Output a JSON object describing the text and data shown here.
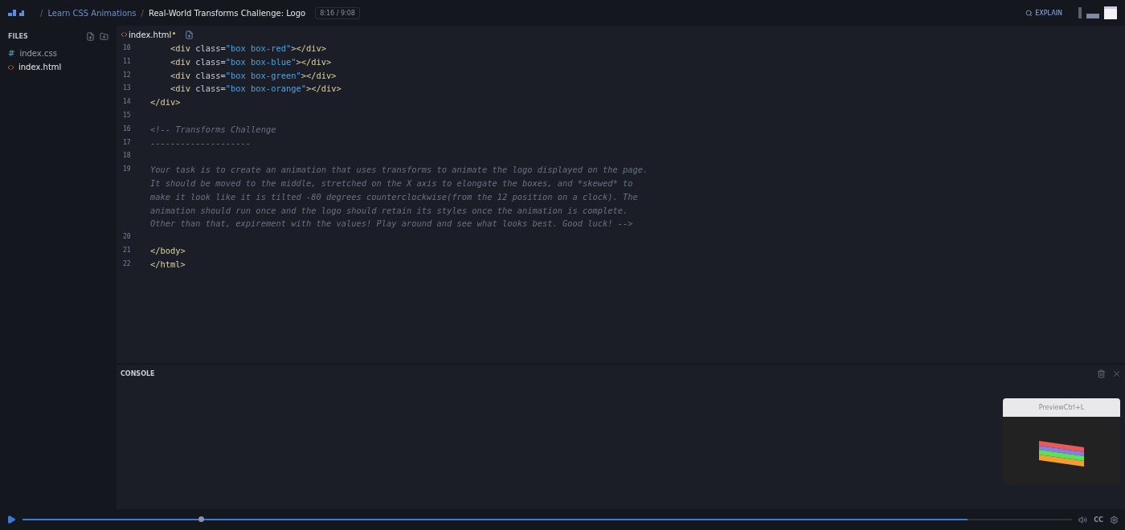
{
  "header": {
    "crumbs": [
      {
        "separator": "/",
        "label": "Learn CSS Animations",
        "kind": "link"
      },
      {
        "separator": "/",
        "label": "Real-World Transforms Challenge: Logo",
        "kind": "current"
      }
    ],
    "time": "8:16 / 9:08",
    "explain": "EXPLAIN"
  },
  "sidebar": {
    "title": "FILES",
    "files": [
      {
        "name": "index.css",
        "kind": "css",
        "glyph": "#",
        "selected": false
      },
      {
        "name": "index.html",
        "kind": "html",
        "selected": true
      }
    ]
  },
  "editor": {
    "tab": {
      "name": "index.html",
      "modified": true
    },
    "lines": [
      {
        "n": "10",
        "kind": "nested",
        "tokens": [
          {
            "kind": "tag",
            "t": "<div "
          },
          {
            "kind": "attr",
            "t": "class="
          },
          {
            "kind": "str",
            "t": "\"box box-red\""
          },
          {
            "kind": "tag",
            "t": "></div>"
          }
        ]
      },
      {
        "n": "11",
        "kind": "nested",
        "tokens": [
          {
            "kind": "tag",
            "t": "<div "
          },
          {
            "kind": "attr",
            "t": "class="
          },
          {
            "kind": "str",
            "t": "\"box box-blue\""
          },
          {
            "kind": "tag",
            "t": "></div>"
          }
        ]
      },
      {
        "n": "12",
        "kind": "nested",
        "tokens": [
          {
            "kind": "tag",
            "t": "<div "
          },
          {
            "kind": "attr",
            "t": "class="
          },
          {
            "kind": "str",
            "t": "\"box box-green\""
          },
          {
            "kind": "tag",
            "t": "></div>"
          }
        ]
      },
      {
        "n": "13",
        "kind": "nested",
        "tokens": [
          {
            "kind": "tag",
            "t": "<div "
          },
          {
            "kind": "attr",
            "t": "class="
          },
          {
            "kind": "str",
            "t": "\"box box-orange\""
          },
          {
            "kind": "tag",
            "t": "></div>"
          }
        ]
      },
      {
        "n": "14",
        "kind": "top",
        "tokens": [
          {
            "kind": "tag",
            "t": "</div>"
          }
        ]
      },
      {
        "n": "15"
      },
      {
        "n": "16",
        "kind": "top",
        "tokens": [
          {
            "kind": "comment",
            "t": "<!-- Transforms Challenge"
          }
        ]
      },
      {
        "n": "17",
        "kind": "top",
        "tokens": [
          {
            "kind": "comment",
            "t": "--------------------"
          }
        ]
      },
      {
        "n": "18"
      },
      {
        "n": "19",
        "kind": "top",
        "tokens": [
          {
            "kind": "comment",
            "t": "Your task is to create an animation that uses transforms to animate the logo displayed on the page.\nIt should be moved to the middle, stretched on the X axis to elongate the boxes, and *skewed* to\nmake it look like it is tilted -80 degrees counterclockwise(from the 12 position on a clock). The\nanimation should run once and the logo should retain its styles once the animation is complete.\nOther than that, expirement with the values! Play around and see what looks best. Good luck! -->"
          }
        ]
      },
      {
        "n": "20"
      },
      {
        "n": "21",
        "kind": "top",
        "tokens": [
          {
            "kind": "tag",
            "t": "</body>"
          }
        ]
      },
      {
        "n": "22",
        "kind": "top",
        "tokens": [
          {
            "kind": "tag",
            "t": "</html>"
          }
        ]
      }
    ]
  },
  "console": {
    "title": "CONSOLE"
  },
  "preview": {
    "title": "PreviewCtrl+L"
  },
  "player": {
    "level": 0.9,
    "cc": "CC"
  }
}
